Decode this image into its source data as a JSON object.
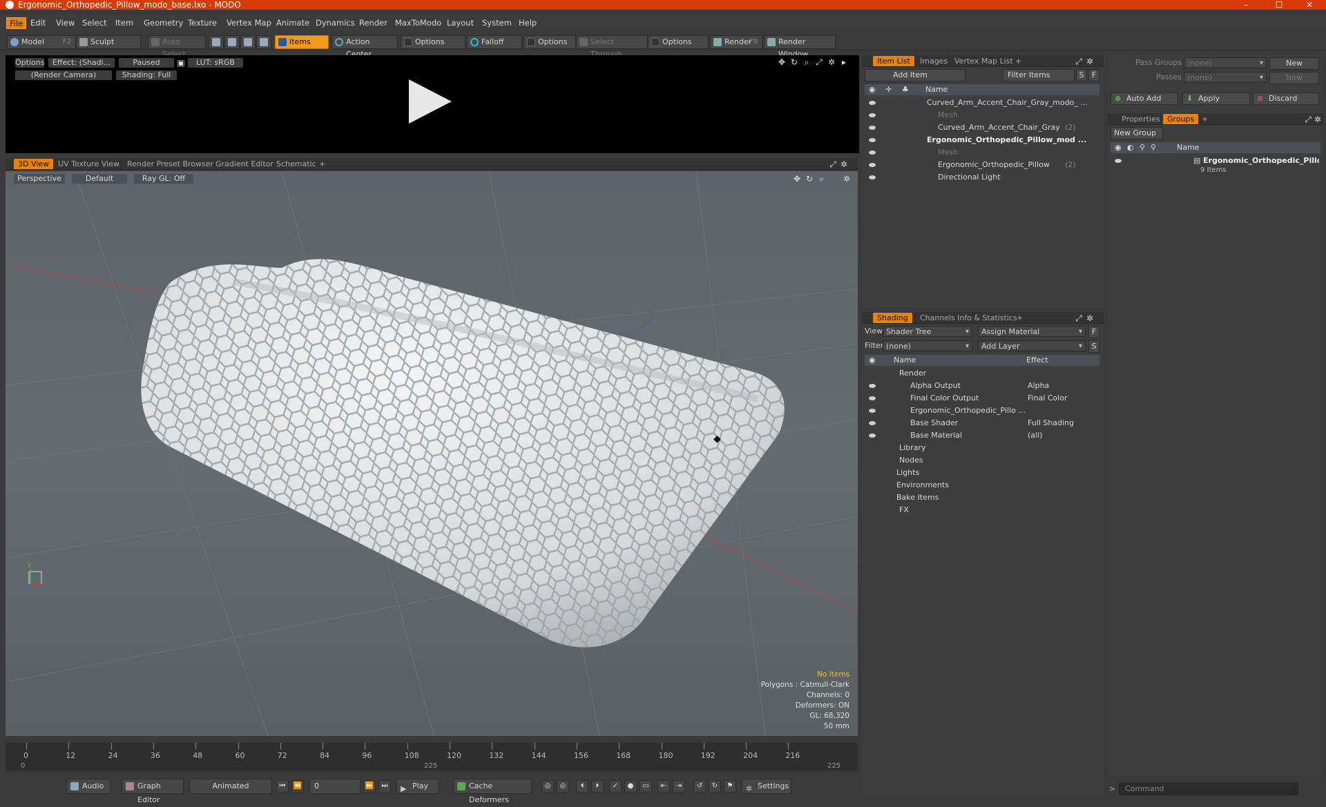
{
  "window": {
    "title": "Ergonomic_Orthopedic_Pillow_modo_base.lxo - MODO",
    "controls": [
      "–",
      "☐",
      "✕"
    ]
  },
  "menu": [
    "File",
    "Edit",
    "View",
    "Select",
    "Item",
    "Geometry",
    "Texture",
    "Vertex Map",
    "Animate",
    "Dynamics",
    "Render",
    "MaxToModo",
    "Layout",
    "System",
    "Help"
  ],
  "toolbar": {
    "model": "Model",
    "model_key": "F2",
    "sculpt": "Sculpt",
    "auto_select": "Auto Select",
    "items": "Items",
    "action_center": "Action Center",
    "options1": "Options",
    "falloff": "Falloff",
    "options2": "Options",
    "select_through": "Select Through",
    "options3": "Options",
    "render": "Render",
    "render_key": "F9",
    "render_window": "Render Window"
  },
  "preview": {
    "options": "Options",
    "effect": "Effect: (Shadi...",
    "paused": "Paused",
    "lut": "LUT: sRGB",
    "camera": "(Render Camera)",
    "shading": "Shading: Full"
  },
  "viewport_tabs": [
    "3D View",
    "UV Texture View",
    "Render Preset Browser",
    "Gradient Editor",
    "Schematic",
    "+"
  ],
  "viewport": {
    "perspective": "Perspective",
    "default": "Default",
    "raygl": "Ray GL: Off",
    "stats": {
      "no_items": "No Items",
      "polygons": "Polygons : Catmull-Clark",
      "channels": "Channels: 0",
      "deformers": "Deformers: ON",
      "gl": "GL: 68,320",
      "focal": "50 mm"
    },
    "axis_y": "Y"
  },
  "timeline": {
    "ticks": [
      "0",
      "12",
      "24",
      "36",
      "48",
      "60",
      "72",
      "84",
      "96",
      "108",
      "120",
      "132",
      "144",
      "156",
      "168",
      "180",
      "192",
      "204",
      "216"
    ],
    "range_start": "0",
    "range_mid": "225",
    "range_end": "225"
  },
  "bottom": {
    "audio": "Audio",
    "graph_editor": "Graph Editor",
    "animated": "Animated",
    "frame": "0",
    "play": "Play",
    "cache_deformers": "Cache Deformers",
    "settings": "Settings"
  },
  "itemlist": {
    "tabs": [
      "Item List",
      "Images",
      "Vertex Map List",
      "+"
    ],
    "add_item": "Add Item",
    "filter_items": "Filter Items",
    "s": "S",
    "f": "F",
    "col_name": "Name",
    "rows": [
      {
        "label": "Curved_Arm_Accent_Chair_Gray_modo_ ...",
        "count": "",
        "indent": 0,
        "style": "normal"
      },
      {
        "label": "Mesh",
        "count": "",
        "indent": 1,
        "style": "dim"
      },
      {
        "label": "Curved_Arm_Accent_Chair_Gray",
        "count": "(2)",
        "indent": 1,
        "style": "normal"
      },
      {
        "label": "Ergonomic_Orthopedic_Pillow_mod ...",
        "count": "",
        "indent": 0,
        "style": "bold"
      },
      {
        "label": "Mesh",
        "count": "",
        "indent": 1,
        "style": "dim"
      },
      {
        "label": "Ergonomic_Orthopedic_Pillow",
        "count": "(2)",
        "indent": 1,
        "style": "normal"
      },
      {
        "label": "Directional Light",
        "count": "",
        "indent": 1,
        "style": "normal"
      }
    ]
  },
  "shading": {
    "tabs": [
      "Shading",
      "Channels",
      "Info & Statistics",
      "+"
    ],
    "view_label": "View",
    "view_value": "Shader Tree",
    "assign_material": "Assign Material",
    "filter_label": "Filter",
    "filter_value": "(none)",
    "add_layer": "Add Layer",
    "f": "F",
    "s": "S",
    "col_name": "Name",
    "col_effect": "Effect",
    "rows": [
      {
        "label": "Render",
        "effect": "",
        "indent": 0
      },
      {
        "label": "Alpha Output",
        "effect": "Alpha",
        "indent": 1
      },
      {
        "label": "Final Color Output",
        "effect": "Final Color",
        "indent": 1
      },
      {
        "label": "Ergonomic_Orthopedic_Pillo ...",
        "effect": "",
        "indent": 1
      },
      {
        "label": "Base Shader",
        "effect": "Full Shading",
        "indent": 1
      },
      {
        "label": "Base Material",
        "effect": "(all)",
        "indent": 1
      },
      {
        "label": "Library",
        "effect": "",
        "indent": 0
      },
      {
        "label": "Nodes",
        "effect": "",
        "indent": 0
      },
      {
        "label": "Lights",
        "effect": "",
        "indent": -1
      },
      {
        "label": "Environments",
        "effect": "",
        "indent": -1
      },
      {
        "label": "Bake Items",
        "effect": "",
        "indent": -1
      },
      {
        "label": "FX",
        "effect": "",
        "indent": 0
      }
    ]
  },
  "passes": {
    "pass_groups": "Pass Groups",
    "pass_groups_value": "(none)",
    "passes": "Passes",
    "passes_value": "(none)",
    "new": "New",
    "auto_add": "Auto Add",
    "apply": "Apply",
    "discard": "Discard"
  },
  "groups": {
    "tabs": [
      "Properties",
      "Groups",
      "+"
    ],
    "new_group": "New Group",
    "col_name": "Name",
    "group_name": "Ergonomic_Orthopedic_Pillo...",
    "group_count": "9 Items"
  },
  "command": {
    "placeholder": "Command",
    "chevron": ">"
  }
}
